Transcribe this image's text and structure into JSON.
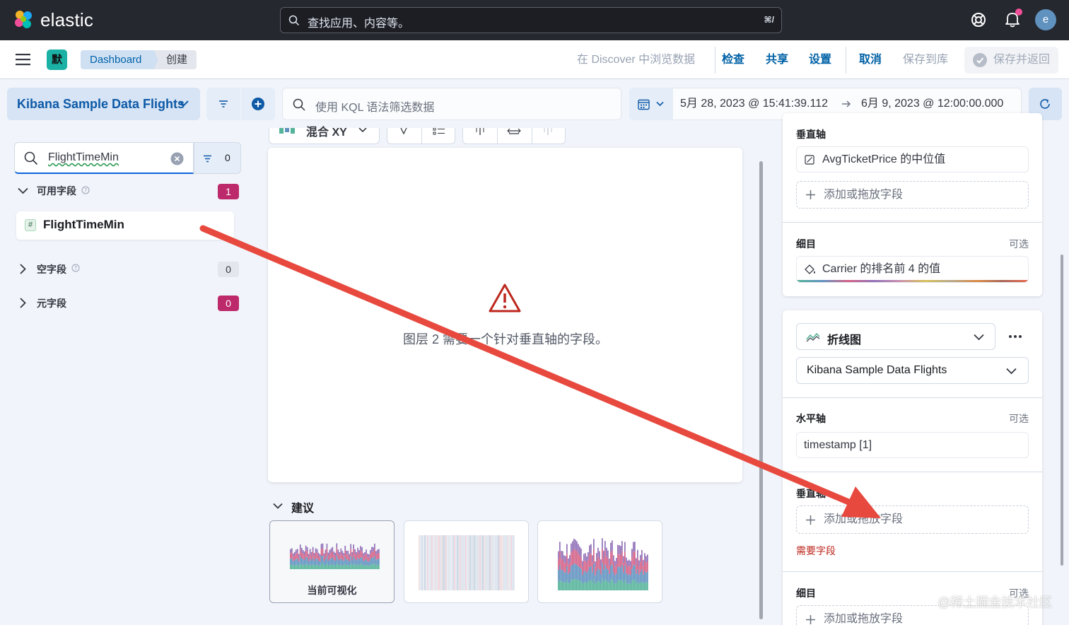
{
  "header": {
    "brand": "elastic",
    "search_placeholder": "查找应用、内容等。",
    "shortcut": "⌘/",
    "avatar_letter": "e"
  },
  "appbar": {
    "space": "默",
    "breadcrumbs": [
      "Dashboard",
      "创建"
    ],
    "actions": {
      "discover": "在 Discover 中浏览数据",
      "inspect": "检查",
      "share": "共享",
      "settings": "设置",
      "cancel": "取消",
      "save_library": "保存到库",
      "save_return": "保存并返回"
    }
  },
  "querybar": {
    "dataview": "Kibana Sample Data Flights",
    "kql_placeholder": "使用 KQL 语法筛选数据",
    "date_start": "5月 28, 2023 @ 15:41:39.112",
    "date_end": "6月 9, 2023 @ 12:00:00.000"
  },
  "fields": {
    "search_value": "FlightTimeMin",
    "filter_count": "0",
    "sections": [
      {
        "label": "可用字段",
        "count": "1"
      },
      {
        "label": "空字段",
        "count": "0"
      },
      {
        "label": "元字段",
        "count": "0"
      }
    ],
    "available_item": "FlightTimeMin",
    "type_tag": "#"
  },
  "workspace": {
    "chart_type": "混合 XY",
    "warning": "图层 2 需要一个针对垂直轴的字段。",
    "suggestions_title": "建议",
    "current_viz": "当前可视化"
  },
  "layer1": {
    "vertical_label": "垂直轴",
    "vertical_value": "AvgTicketPrice 的中位值",
    "add_field": "添加或拖放字段",
    "breakdown_label": "细目",
    "optional": "可选",
    "breakdown_value": "Carrier 的排名前 4 的值"
  },
  "layer2": {
    "type": "折线图",
    "dataview": "Kibana Sample Data Flights",
    "horizontal_label": "水平轴",
    "optional": "可选",
    "horizontal_value": "timestamp [1]",
    "vertical_label": "垂直轴",
    "add_field": "添加或拖放字段",
    "required": "需要字段",
    "breakdown_label": "细目",
    "breakdown_add": "添加或拖放字段"
  },
  "watermark": "@稀土掘金技术社区",
  "colors": {
    "accent": "#0061a6",
    "annotation_arrow": "#e8493f",
    "danger": "#bd271e",
    "badge_pink": "#bd2a6c"
  }
}
